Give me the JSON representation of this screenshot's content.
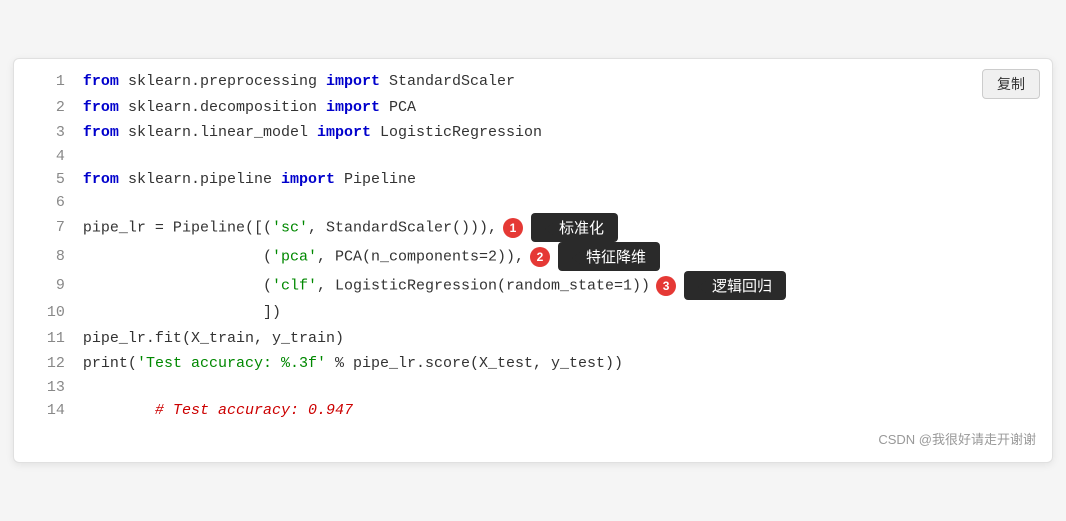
{
  "copy_button": "复制",
  "lines": [
    {
      "num": 1,
      "parts": [
        {
          "t": "kw",
          "v": "from"
        },
        {
          "t": "txt",
          "v": " sklearn.preprocessing "
        },
        {
          "t": "kw",
          "v": "import"
        },
        {
          "t": "txt",
          "v": " StandardScaler"
        }
      ],
      "annotation": null
    },
    {
      "num": 2,
      "parts": [
        {
          "t": "kw",
          "v": "from"
        },
        {
          "t": "txt",
          "v": " sklearn.decomposition "
        },
        {
          "t": "kw",
          "v": "import"
        },
        {
          "t": "txt",
          "v": " PCA"
        }
      ],
      "annotation": null
    },
    {
      "num": 3,
      "parts": [
        {
          "t": "kw",
          "v": "from"
        },
        {
          "t": "txt",
          "v": " sklearn.linear_model "
        },
        {
          "t": "kw",
          "v": "import"
        },
        {
          "t": "txt",
          "v": " LogisticRegression"
        }
      ],
      "annotation": null
    },
    {
      "num": 4,
      "parts": [],
      "annotation": null
    },
    {
      "num": 5,
      "parts": [
        {
          "t": "kw",
          "v": "from"
        },
        {
          "t": "txt",
          "v": " sklearn.pipeline "
        },
        {
          "t": "kw",
          "v": "import"
        },
        {
          "t": "txt",
          "v": " Pipeline"
        }
      ],
      "annotation": null
    },
    {
      "num": 6,
      "parts": [],
      "annotation": null
    },
    {
      "num": 7,
      "parts": [
        {
          "t": "txt",
          "v": "pipe_lr = Pipeline([("
        },
        {
          "t": "str",
          "v": "'sc'"
        },
        {
          "t": "txt",
          "v": ", StandardScaler())),"
        }
      ],
      "annotation": {
        "badge": "1",
        "label": "标准化"
      }
    },
    {
      "num": 8,
      "parts": [
        {
          "t": "txt",
          "v": "                    ("
        },
        {
          "t": "str",
          "v": "'pca'"
        },
        {
          "t": "txt",
          "v": ", PCA(n_components=2)),"
        }
      ],
      "annotation": {
        "badge": "2",
        "label": "特征降维"
      }
    },
    {
      "num": 9,
      "parts": [
        {
          "t": "txt",
          "v": "                    ("
        },
        {
          "t": "str",
          "v": "'clf'"
        },
        {
          "t": "txt",
          "v": ", LogisticRegression(random_state=1))"
        }
      ],
      "annotation": {
        "badge": "3",
        "label": "逻辑回归"
      }
    },
    {
      "num": 10,
      "parts": [
        {
          "t": "txt",
          "v": "                    ])"
        }
      ],
      "annotation": null
    },
    {
      "num": 11,
      "parts": [
        {
          "t": "txt",
          "v": "pipe_lr.fit(X_train, y_train)"
        }
      ],
      "annotation": null
    },
    {
      "num": 12,
      "parts": [
        {
          "t": "txt",
          "v": "print("
        },
        {
          "t": "str",
          "v": "'Test accuracy: %.3f'"
        },
        {
          "t": "txt",
          "v": " % pipe_lr.score(X_test, y_test))"
        }
      ],
      "annotation": null
    },
    {
      "num": 13,
      "parts": [],
      "annotation": null
    },
    {
      "num": 14,
      "parts": [
        {
          "t": "comment",
          "v": "        # Test accuracy: 0.947"
        }
      ],
      "annotation": null
    }
  ],
  "footer": "CSDN @我很好请走开谢谢"
}
